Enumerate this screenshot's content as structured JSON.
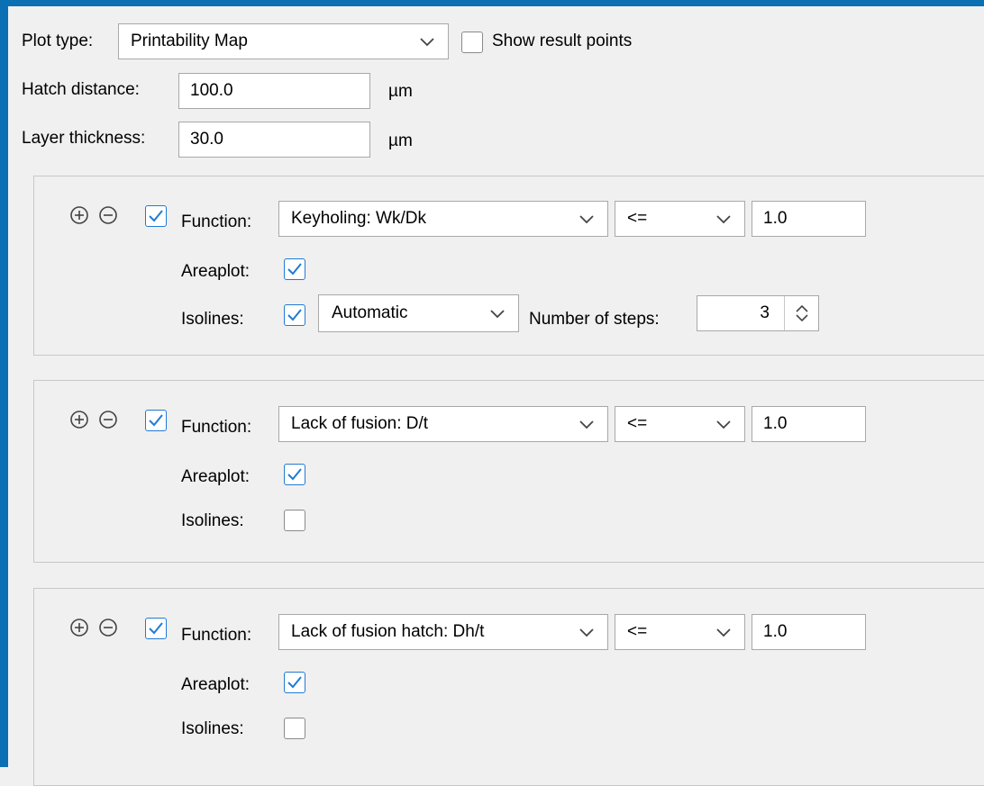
{
  "top": {
    "plot_type_label": "Plot type:",
    "plot_type_value": "Printability Map",
    "show_result_points_label": "Show result points",
    "show_result_points_checked": false,
    "hatch_distance_label": "Hatch distance:",
    "hatch_distance_value": "100.0",
    "hatch_distance_unit": "µm",
    "layer_thickness_label": "Layer thickness:",
    "layer_thickness_value": "30.0",
    "layer_thickness_unit": "µm"
  },
  "labels": {
    "function": "Function:",
    "areaplot": "Areaplot:",
    "isolines": "Isolines:",
    "number_of_steps": "Number of steps:"
  },
  "conditions": [
    {
      "enabled": true,
      "function": "Keyholing: Wk/Dk",
      "operator": "<=",
      "value": "1.0",
      "areaplot": true,
      "isolines": true,
      "isolines_mode": "Automatic",
      "number_of_steps": "3"
    },
    {
      "enabled": true,
      "function": "Lack of fusion: D/t",
      "operator": "<=",
      "value": "1.0",
      "areaplot": true,
      "isolines": false
    },
    {
      "enabled": true,
      "function": "Lack of fusion hatch: Dh/t",
      "operator": "<=",
      "value": "1.0",
      "areaplot": true,
      "isolines": false
    }
  ],
  "icons": {
    "add": "plus-circle-icon",
    "remove": "minus-circle-icon",
    "dropdown": "chevron-down-icon",
    "spinner": "up-down-chevron-icon"
  },
  "colors": {
    "frame": "#0a6fb3",
    "check_accent": "#1f7bd6"
  }
}
